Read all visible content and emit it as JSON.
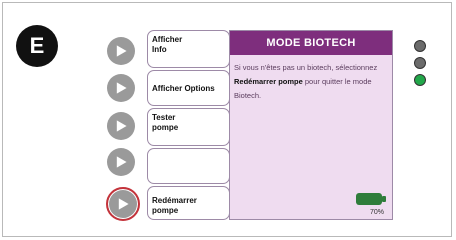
{
  "step": {
    "letter": "E"
  },
  "menu": [
    {
      "line1": "Afficher",
      "line2": "Info"
    },
    {
      "line1": "Afficher Options",
      "line2": ""
    },
    {
      "line1": "Tester",
      "line2": "pompe"
    },
    {
      "line1": "",
      "line2": ""
    },
    {
      "line1": "Redémarrer",
      "line2": "pompe"
    }
  ],
  "screen": {
    "title": "MODE BIOTECH",
    "text_before": "Si vous n'êtes pas un biotech, sélectionnez ",
    "text_bold": "Redémarrer pompe",
    "text_after": " pour quitter le mode Biotech.",
    "battery_percent": "70%"
  },
  "leds": [
    {
      "name": "led-top",
      "color": "#6b6b6b"
    },
    {
      "name": "led-middle",
      "color": "#6b6b6b"
    },
    {
      "name": "led-bottom",
      "color": "#22a74a"
    }
  ],
  "colors": {
    "accent": "#7e2e7d",
    "screen_bg": "#efdcf0",
    "highlight": "#c4333b"
  }
}
